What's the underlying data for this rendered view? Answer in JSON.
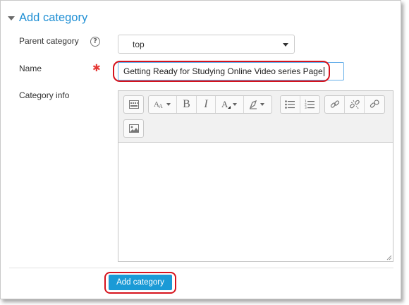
{
  "section": {
    "title": "Add category"
  },
  "form": {
    "parent_category": {
      "label": "Parent category",
      "value": "top"
    },
    "name": {
      "label": "Name",
      "value": "Getting Ready for Studying Online Video series Page"
    },
    "category_info": {
      "label": "Category info",
      "value": ""
    },
    "submit_label": "Add category"
  },
  "editor": {
    "toolbar_icons": [
      "toolbar-toggle-icon",
      "font-style-icon",
      "bold-icon",
      "italic-icon",
      "text-color-icon",
      "background-color-icon",
      "unordered-list-icon",
      "ordered-list-icon",
      "link-icon",
      "unlink-icon",
      "bookmark-icon",
      "image-icon"
    ],
    "bold_glyph": "B",
    "italic_glyph": "I"
  },
  "colors": {
    "accent": "#1f8fd4",
    "button": "#1a9ad6",
    "highlight": "#d6131d",
    "required": "#e53935"
  }
}
